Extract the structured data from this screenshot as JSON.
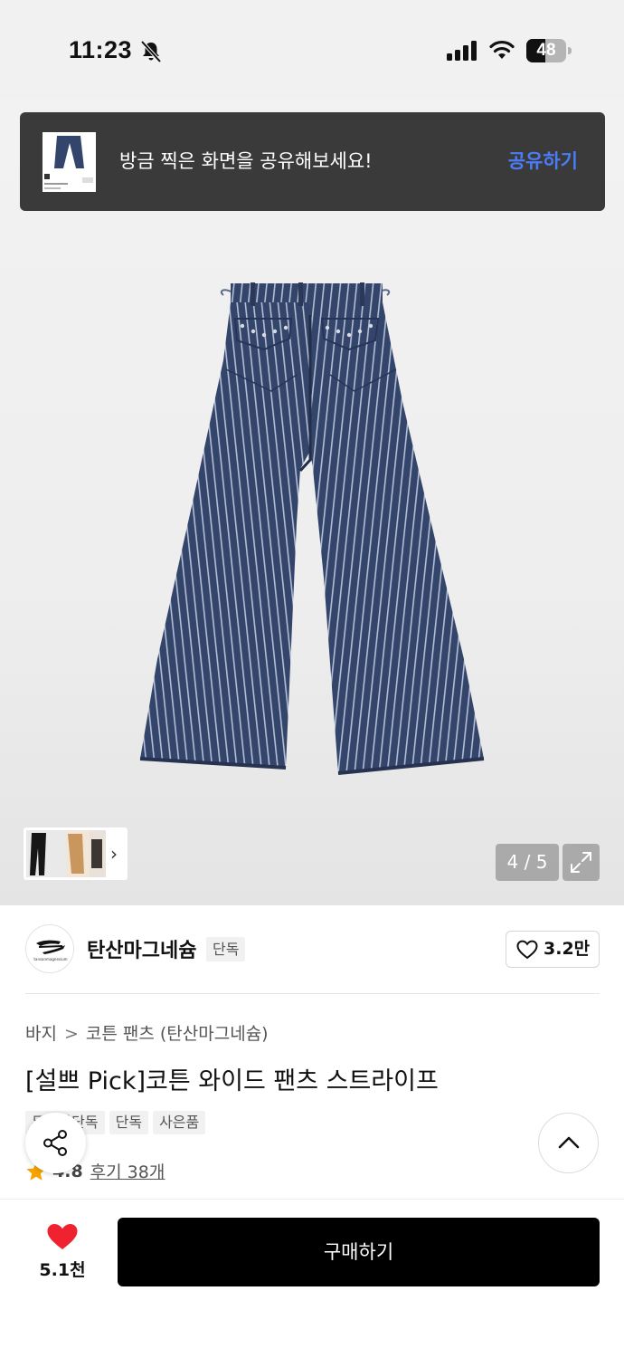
{
  "status_bar": {
    "time": "11:23",
    "battery_level": "48",
    "battery_fraction": 0.48
  },
  "toast": {
    "message": "방금 찍은 화면을 공유해보세요!",
    "action_label": "공유하기",
    "action_color": "#4b7cf6"
  },
  "gallery": {
    "counter": "4 / 5",
    "current_index": 4,
    "total": 5,
    "thumbnail_count": 3,
    "product_color": "#34456b"
  },
  "brand": {
    "name": "탄산마그네슘",
    "badge": "단독",
    "logo_caption": "tansanmagnesium",
    "like_count": "3.2만"
  },
  "product": {
    "breadcrumb": [
      "바지",
      "코튼 팬츠 (탄산마그네슘)"
    ],
    "breadcrumb_separator": ">",
    "title": "[설쁘 Pick]코튼 와이드 팬츠 스트라이프",
    "tags": [
      "무신사단독",
      "단독",
      "사은품"
    ],
    "rating": "4.8",
    "reviews_label": "후기 38개"
  },
  "bottom_bar": {
    "wish_count": "5.1천",
    "buy_label": "구매하기",
    "heart_color": "#f0222f"
  },
  "icons": {
    "notifications": "bell-slash-icon",
    "share": "share-icon",
    "scroll_top": "chevron-up-icon",
    "expand": "expand-icon"
  }
}
